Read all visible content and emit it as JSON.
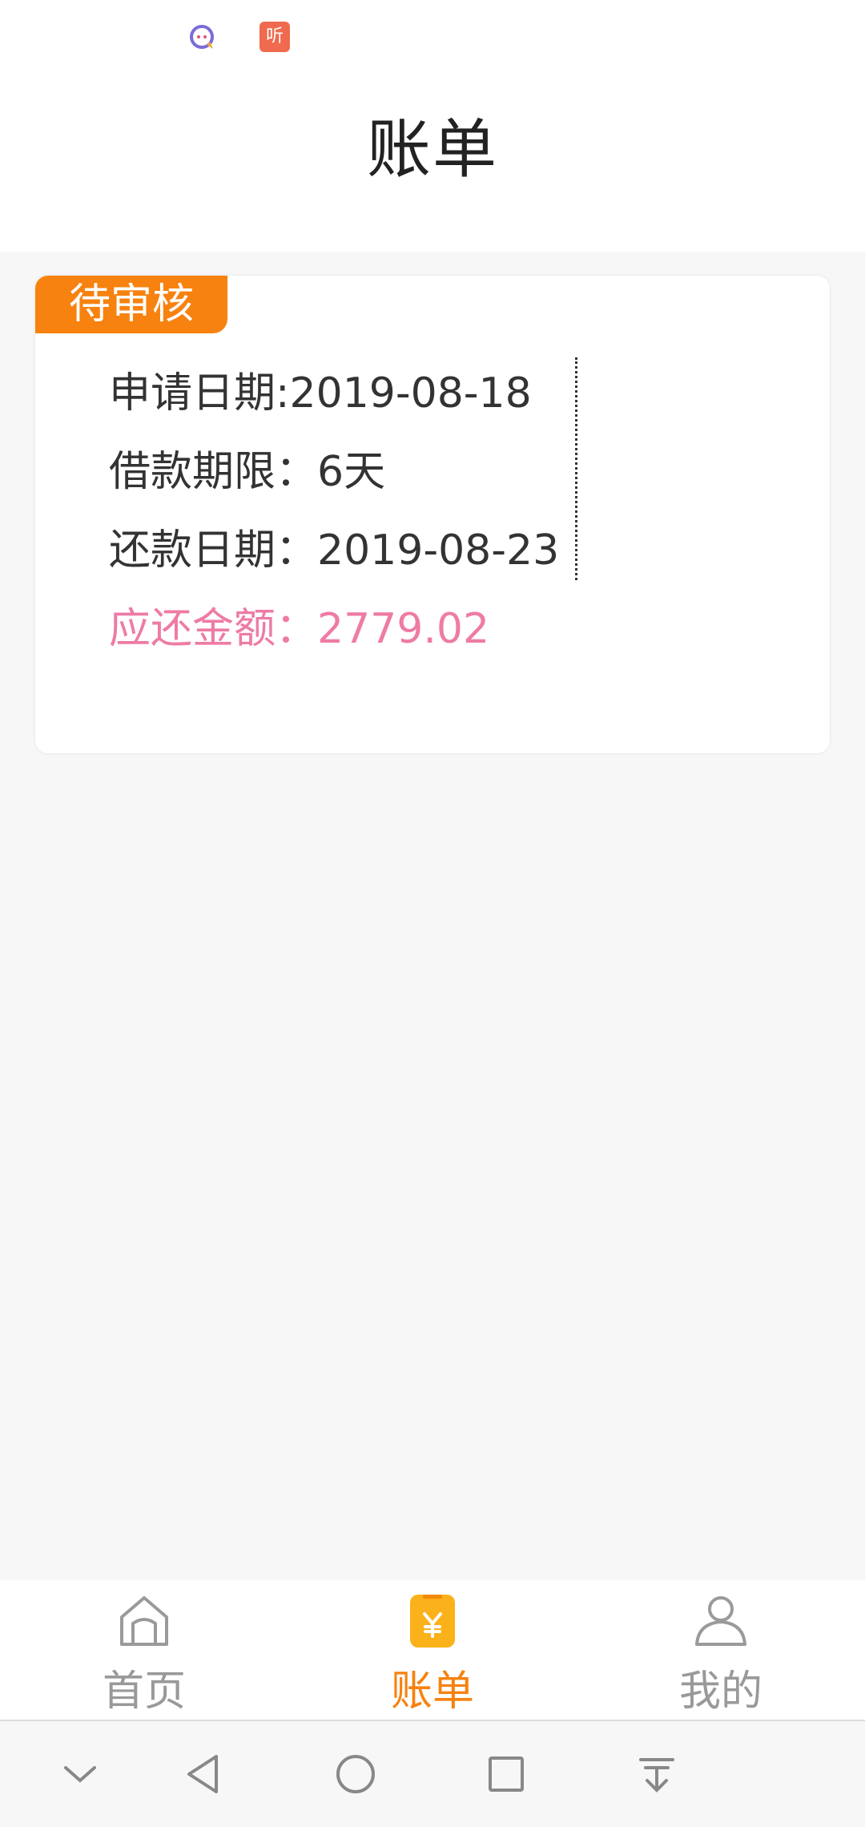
{
  "status_bar": {
    "icons": [
      "chat-bubble-icon",
      "listen-app-icon"
    ],
    "listen_glyph": "听"
  },
  "header": {
    "title": "账单"
  },
  "bill_card": {
    "status_tag": "待审核",
    "apply_date": "申请日期:2019-08-18",
    "loan_term": "借款期限：6天",
    "repay_date": "还款日期：2019-08-23",
    "amount_due": "应还金额：2779.02"
  },
  "tabbar": {
    "tabs": [
      {
        "label": "首页",
        "icon": "home-icon",
        "active": false
      },
      {
        "label": "账单",
        "icon": "bill-icon",
        "active": true
      },
      {
        "label": "我的",
        "icon": "user-icon",
        "active": false
      }
    ]
  },
  "navbar": {
    "buttons": [
      "collapse-icon",
      "back-icon",
      "home-circle-icon",
      "recents-icon",
      "notification-pull-icon"
    ]
  },
  "colors": {
    "accent": "#f7820f",
    "amount": "#ee7ba5",
    "text": "#333333",
    "inactive": "#999999",
    "background": "#f7f7f7"
  }
}
